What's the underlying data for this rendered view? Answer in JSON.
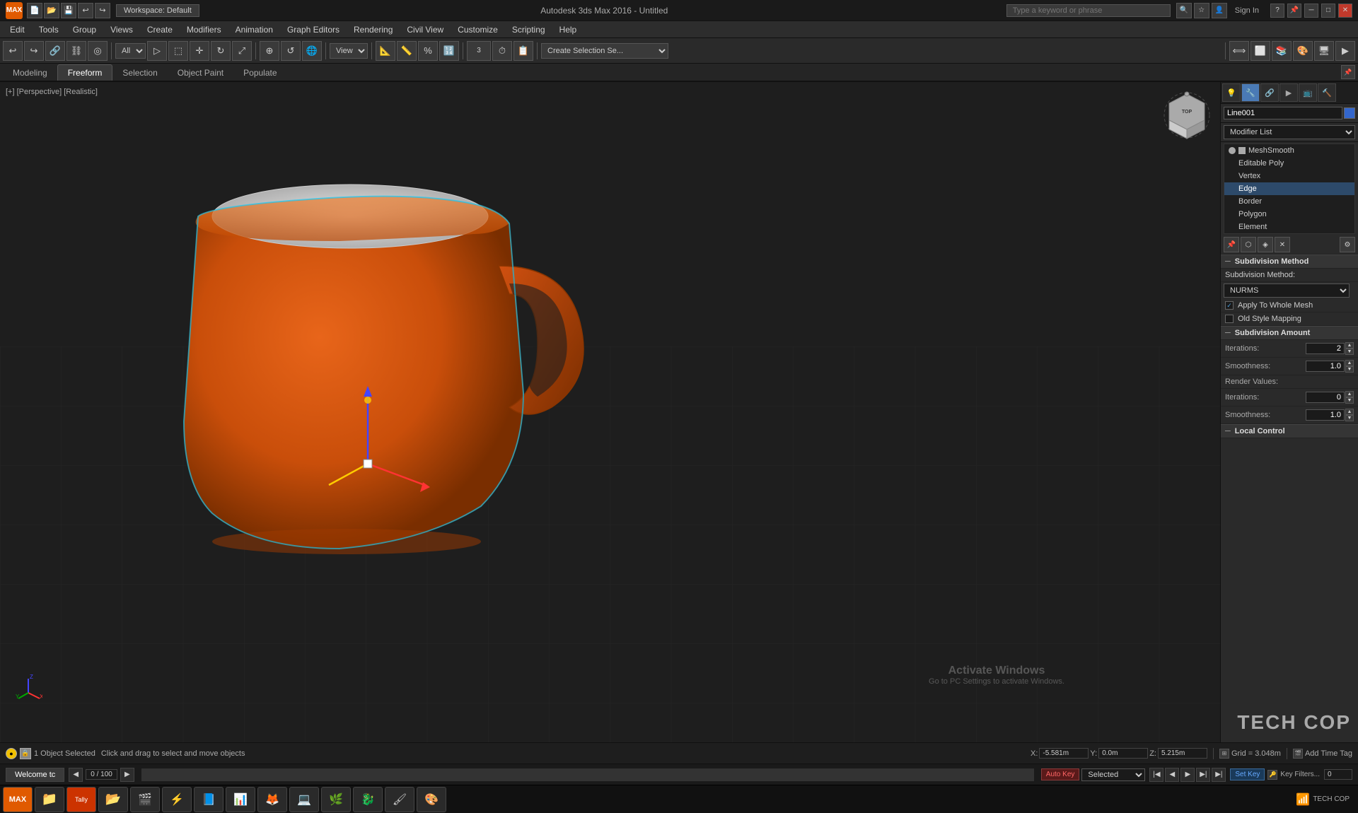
{
  "titlebar": {
    "app_label": "MAX",
    "workspace_label": "Workspace: Default",
    "title": "Autodesk 3ds Max 2016  -  Untitled",
    "search_placeholder": "Type a keyword or phrase",
    "sign_in_label": "Sign In",
    "min_label": "─",
    "max_label": "□",
    "close_label": "✕"
  },
  "menubar": {
    "items": [
      "Edit",
      "Tools",
      "Group",
      "Views",
      "Create",
      "Modifiers",
      "Animation",
      "Graph Editors",
      "Rendering",
      "Civil View",
      "Customize",
      "Scripting",
      "Help"
    ]
  },
  "ribbon": {
    "tabs": [
      "Modeling",
      "Freeform",
      "Selection",
      "Object Paint",
      "Populate"
    ]
  },
  "viewport": {
    "label": "[+] [Perspective] [Realistic]"
  },
  "right_panel": {
    "object_name": "Line001",
    "modifier_list_label": "Modifier List",
    "stack": [
      {
        "label": "MeshSmooth",
        "level": 0,
        "active": false
      },
      {
        "label": "Editable Poly",
        "level": 0,
        "active": false
      },
      {
        "label": "Vertex",
        "level": 1,
        "active": false
      },
      {
        "label": "Edge",
        "level": 1,
        "active": true
      },
      {
        "label": "Border",
        "level": 1,
        "active": false
      },
      {
        "label": "Polygon",
        "level": 1,
        "active": false
      },
      {
        "label": "Element",
        "level": 1,
        "active": false
      }
    ],
    "subdivision_method_header": "Subdivision Method",
    "subdivision_method_label": "Subdivision Method:",
    "subdivision_method_value": "NURMS",
    "apply_whole_mesh_label": "Apply To Whole Mesh",
    "apply_whole_mesh_checked": true,
    "old_style_mapping_label": "Old Style Mapping",
    "old_style_mapping_checked": false,
    "subdivision_amount_header": "Subdivision Amount",
    "iterations_label": "Iterations:",
    "iterations_value": "2",
    "smoothness_label": "Smoothness:",
    "smoothness_value": "1.0",
    "render_values_label": "Render Values:",
    "render_iter_label": "Iterations:",
    "render_iter_value": "0",
    "render_smooth_label": "Smoothness:",
    "render_smooth_value": "1.0",
    "local_control_header": "Local Control"
  },
  "statusbar": {
    "object_count": "1 Object Selected",
    "hint": "Click and drag to select and move objects",
    "x_label": "X:",
    "x_value": "-5.581m",
    "y_label": "Y:",
    "y_value": "0.0m",
    "z_label": "Z:",
    "z_value": "5.215m",
    "grid_label": "Grid =",
    "grid_value": "3.048m",
    "add_time_tag": "Add Time Tag"
  },
  "bottombar": {
    "progress_label": "0 / 100",
    "auto_key_label": "Auto Key",
    "selected_label": "Selected",
    "set_key_label": "Set Key",
    "key_filters_label": "Key Filters...",
    "frame_value": "0",
    "welcome_tab": "Welcome tc"
  },
  "taskbar": {
    "apps": [
      "🟠",
      "📁",
      "🎬",
      "⚡",
      "📘",
      "📊",
      "🌐",
      "💻",
      "🌿",
      "🐉",
      "🖌",
      "🔧"
    ]
  },
  "watermark": {
    "activate": "Activate Windows",
    "activate_sub": "Go to PC Settings to activate Windows.",
    "techcop": "TECH COP"
  }
}
